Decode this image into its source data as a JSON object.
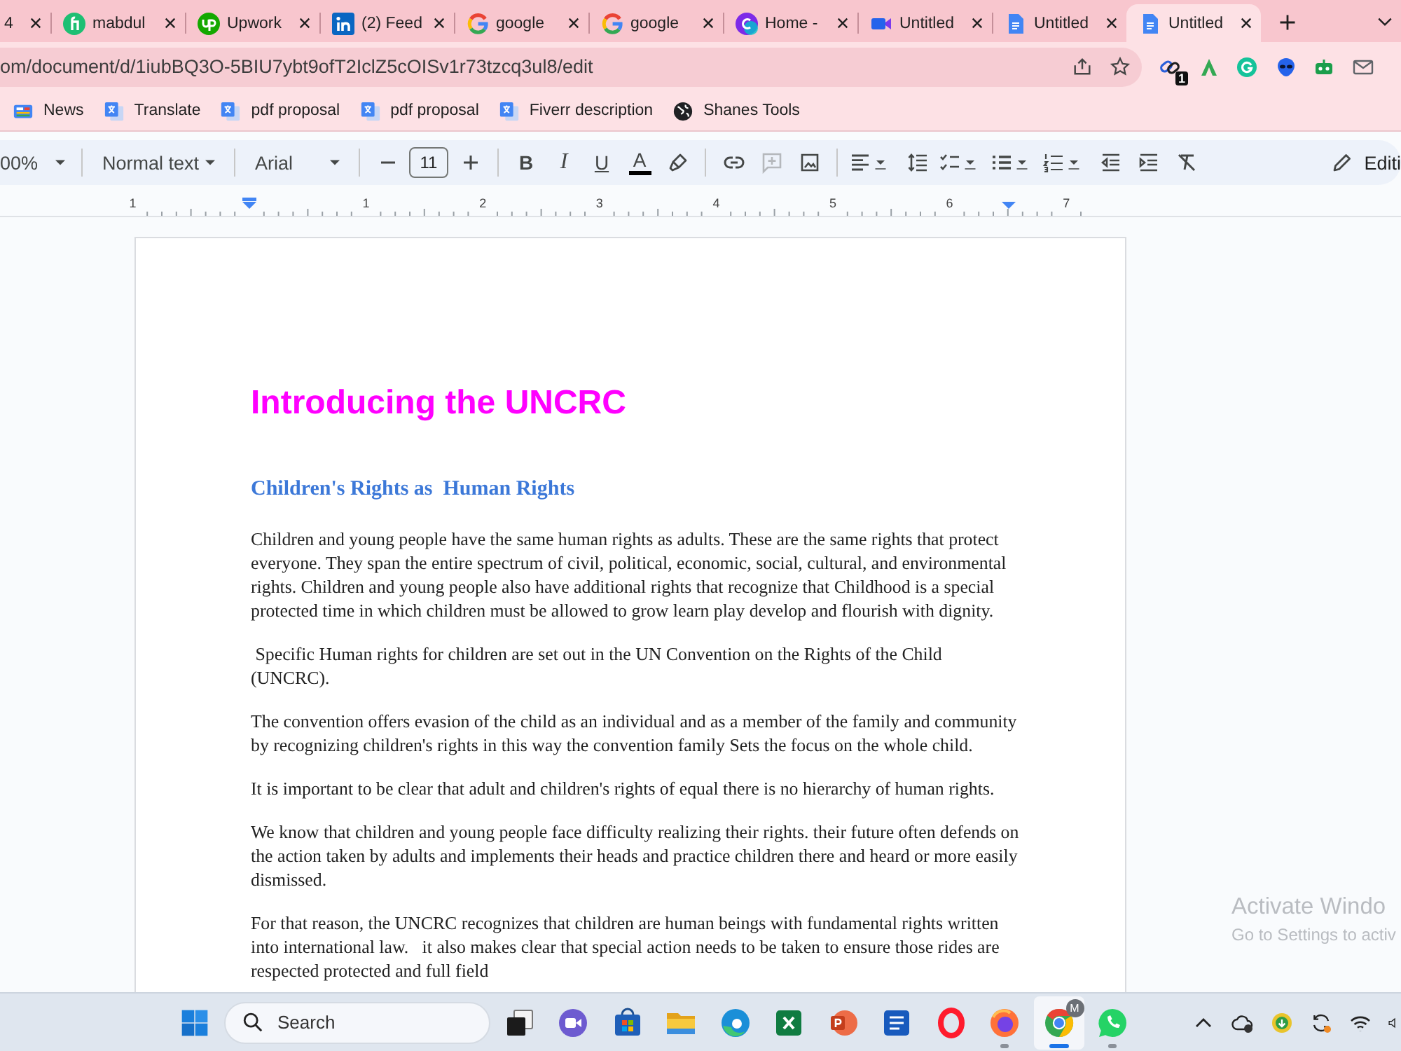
{
  "browser": {
    "tabs": [
      {
        "title": "4",
        "selected": false
      },
      {
        "kind": "fiverr",
        "title": "mabdul",
        "selected": false
      },
      {
        "kind": "upwork",
        "title": "Upwork",
        "selected": false
      },
      {
        "kind": "linkedin",
        "title": "(2) Feed",
        "selected": false
      },
      {
        "kind": "google",
        "title": "google",
        "selected": false
      },
      {
        "kind": "google",
        "title": "google",
        "selected": false
      },
      {
        "kind": "canva",
        "title": "Home -",
        "selected": false
      },
      {
        "kind": "meet",
        "title": "Untitled",
        "selected": false
      },
      {
        "kind": "docs",
        "title": "Untitled",
        "selected": false
      },
      {
        "kind": "docs",
        "title": "Untitled",
        "selected": true
      }
    ],
    "address": "om/document/d/1iubBQ3O-5BIU7ybt9ofT2IclZ5cOISv1r73tzcq3ul8/edit",
    "extensions": [
      {
        "kind": "link",
        "badge": "1"
      },
      {
        "kind": "letter"
      },
      {
        "kind": "grammar"
      },
      {
        "kind": "alien"
      },
      {
        "kind": "robot"
      },
      {
        "kind": "mail"
      }
    ],
    "bookmarks": [
      {
        "kind": "news",
        "label": "News"
      },
      {
        "kind": "translate",
        "label": "Translate"
      },
      {
        "kind": "translate",
        "label": "pdf proposal"
      },
      {
        "kind": "translate",
        "label": "pdf proposal"
      },
      {
        "kind": "translate",
        "label": "Fiverr description"
      },
      {
        "kind": "globe",
        "label": "Shanes Tools"
      }
    ]
  },
  "docs": {
    "toolbar": {
      "zoom": "00%",
      "style": "Normal text",
      "font": "Arial",
      "font_size": "11",
      "format": [
        {
          "kind": "bold",
          "label": "B"
        },
        {
          "kind": "italic",
          "label": "I"
        },
        {
          "kind": "underline",
          "label": "U"
        },
        {
          "kind": "color",
          "label": "A"
        },
        {
          "kind": "highlight"
        }
      ],
      "insert": [
        {
          "kind": "link",
          "disabled": false
        },
        {
          "kind": "comment",
          "disabled": true
        },
        {
          "kind": "image",
          "disabled": false
        }
      ],
      "paragraph": [
        {
          "kind": "align"
        },
        {
          "kind": "spacing"
        },
        {
          "kind": "checklist"
        },
        {
          "kind": "bullets"
        },
        {
          "kind": "numbered"
        },
        {
          "kind": "outdent"
        },
        {
          "kind": "indent"
        },
        {
          "kind": "clear"
        }
      ],
      "mode": "Editi"
    },
    "ruler": [
      "1",
      "1",
      "2",
      "3",
      "4",
      "5",
      "6",
      "7"
    ],
    "document": {
      "title": "Introducing the UNCRC",
      "heading": "Children's Rights as  Human Rights",
      "paragraphs": [
        "Children and young people have the same human rights as adults. These are the same rights that protect everyone. They span the entire spectrum of civil, political, economic, social, cultural, and environmental rights. Children and young people also have additional rights that recognize that Childhood is a special protected time in which children must be allowed to grow learn play develop and flourish with dignity.",
        " Specific Human rights for children are set out in the UN Convention on the Rights of the Child (UNCRC).",
        "The convention offers evasion of the child as an individual and as a member of the family and community by recognizing children's rights in this way the convention family Sets the focus on the whole child.",
        "It is important to be clear that adult and children's rights of equal there is no hierarchy of human rights.",
        "We know that children and young people face difficulty realizing their rights. their future often defends on the action taken by adults and implements their heads and practice children there and heard or more easily dismissed.",
        "For that reason, the UNCRC recognizes that children are human beings with fundamental rights written into international law.   it also makes clear that special action needs to be taken to ensure those rides are respected protected and full field"
      ]
    }
  },
  "activation": {
    "title": "Activate Windo",
    "detail": "Go to Settings to activ"
  },
  "taskbar": {
    "search": {
      "placeholder": "Search"
    },
    "apps": [
      {
        "kind": "taskview",
        "running": false,
        "selected": false
      },
      {
        "kind": "meet",
        "running": false,
        "selected": false
      },
      {
        "kind": "store",
        "running": false,
        "selected": false
      },
      {
        "kind": "files",
        "running": false,
        "selected": false
      },
      {
        "kind": "edge",
        "running": false,
        "selected": false
      },
      {
        "kind": "excel",
        "running": false,
        "selected": false
      },
      {
        "kind": "powerpoint",
        "running": false,
        "selected": false
      },
      {
        "kind": "word",
        "running": false,
        "selected": false
      },
      {
        "kind": "opera",
        "running": false,
        "selected": false
      },
      {
        "kind": "firefox",
        "running": true,
        "selected": false
      },
      {
        "kind": "chrome",
        "running": true,
        "selected": true,
        "badge": "M"
      },
      {
        "kind": "whatsapp",
        "running": true,
        "selected": false
      }
    ],
    "tray": [
      {
        "kind": "chevron"
      },
      {
        "kind": "cloud"
      },
      {
        "kind": "coin"
      },
      {
        "kind": "sync"
      },
      {
        "kind": "wifi"
      },
      {
        "kind": "speaker"
      }
    ]
  }
}
